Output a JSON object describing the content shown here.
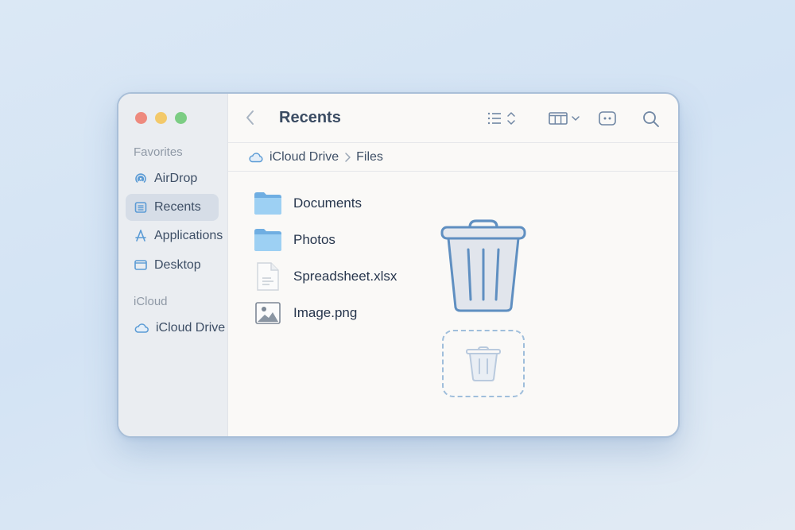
{
  "window": {
    "title": "Recents",
    "traffic_lights": {
      "close": "#ee8a7e",
      "minimize": "#f3c96a",
      "zoom": "#7ccd84"
    }
  },
  "sidebar": {
    "favorites_label": "Favorites",
    "favorites": [
      {
        "label": "AirDrop",
        "icon": "airdrop-icon"
      },
      {
        "label": "Recents",
        "icon": "recents-icon",
        "active": true
      },
      {
        "label": "Applications",
        "icon": "applications-icon"
      },
      {
        "label": "Desktop",
        "icon": "desktop-icon"
      }
    ],
    "icloud_label": "iCloud",
    "icloud": [
      {
        "label": "iCloud Drive",
        "icon": "cloud-icon"
      }
    ]
  },
  "toolbar": {
    "icons": [
      "back-chevron-icon",
      "list-view-icon",
      "sort-icon",
      "column-view-icon",
      "chevron-down-icon",
      "more-icon",
      "search-icon"
    ]
  },
  "pathbar": {
    "segments": [
      "iCloud Drive",
      "Files"
    ]
  },
  "files": [
    {
      "name": "Documents",
      "icon": "folder-icon"
    },
    {
      "name": "Photos",
      "icon": "folder-icon"
    },
    {
      "name": "Spreadsheet.xlsx",
      "icon": "document-icon"
    },
    {
      "name": "Image.png",
      "icon": "image-icon"
    }
  ],
  "trash": {
    "icon": "trash-icon",
    "drop_zone_icon": "trash-drop-icon"
  },
  "colors": {
    "accent": "#5b9bd5",
    "folder": "#8cc4ee",
    "text": "#27364d"
  }
}
